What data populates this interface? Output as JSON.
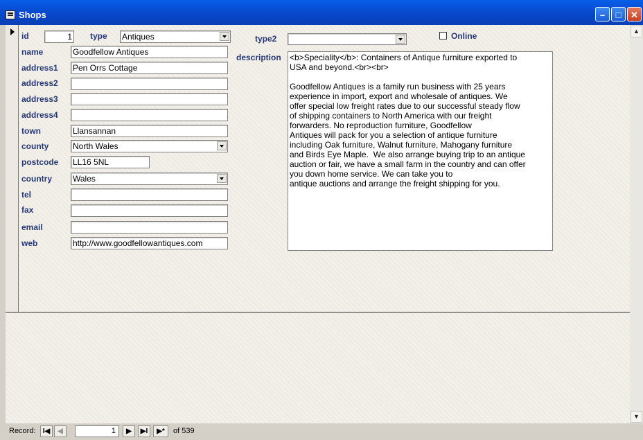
{
  "window": {
    "title": "Shops",
    "min_glyph": "–",
    "max_glyph": "□",
    "close_glyph": "✕"
  },
  "fields": {
    "id": {
      "label": "id",
      "value": "1"
    },
    "type": {
      "label": "type",
      "value": "Antiques"
    },
    "type2": {
      "label": "type2",
      "value": ""
    },
    "online": {
      "label": "Online",
      "checked": false
    },
    "name": {
      "label": "name",
      "value": "Goodfellow Antiques"
    },
    "address1": {
      "label": "address1",
      "value": "Pen Orrs Cottage"
    },
    "address2": {
      "label": "address2",
      "value": ""
    },
    "address3": {
      "label": "address3",
      "value": ""
    },
    "address4": {
      "label": "address4",
      "value": ""
    },
    "town": {
      "label": "town",
      "value": "Llansannan"
    },
    "county": {
      "label": "county",
      "value": "North Wales"
    },
    "postcode": {
      "label": "postcode",
      "value": "LL16 5NL"
    },
    "country": {
      "label": "country",
      "value": "Wales"
    },
    "tel": {
      "label": "tel",
      "value": ""
    },
    "fax": {
      "label": "fax",
      "value": ""
    },
    "email": {
      "label": "email",
      "value": ""
    },
    "web": {
      "label": "web",
      "value": "http://www.goodfellowantiques.com"
    },
    "description": {
      "label": "description",
      "value": "<b>Speciality</b>: Containers of Antique furniture exported to\nUSA and beyond.<br><br>\n\nGoodfellow Antiques is a family run business with 25 years\nexperience in import, export and wholesale of antiques. We\noffer special low freight rates due to our successful steady flow\nof shipping containers to North America with our freight\nforwarders. No reproduction furniture, Goodfellow\nAntiques will pack for you a selection of antique furniture\nincluding Oak furniture, Walnut furniture, Mahogany furniture\nand Birds Eye Maple.  We also arrange buying trip to an antique\nauction or fair, we have a small farm in the country and can offer\nyou down home service. We can take you to\nantique auctions and arrange the freight shipping for you."
    }
  },
  "navigation": {
    "record_label": "Record:",
    "current_record": "1",
    "of_label": "of  539",
    "first": "I◀",
    "prev": "◀",
    "next": "▶",
    "last": "▶I",
    "new": "▶*"
  },
  "scrollbar": {
    "up": "▲",
    "down": "▼"
  }
}
